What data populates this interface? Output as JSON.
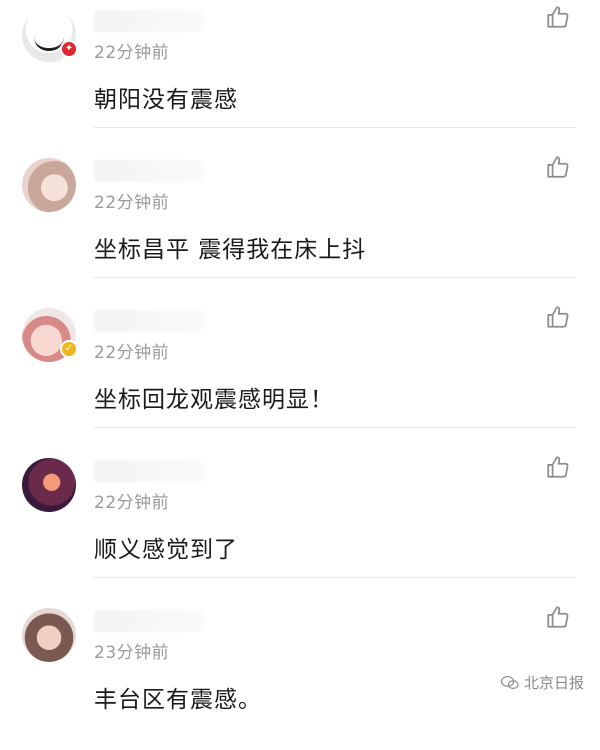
{
  "comments": [
    {
      "time": "22分钟前",
      "text": "朝阳没有震感",
      "badge": "red"
    },
    {
      "time": "22分钟前",
      "text": "坐标昌平 震得我在床上抖",
      "badge": ""
    },
    {
      "time": "22分钟前",
      "text": "坐标回龙观震感明显！",
      "badge": "gold"
    },
    {
      "time": "22分钟前",
      "text": "顺义感觉到了",
      "badge": ""
    },
    {
      "time": "23分钟前",
      "text": "丰台区有震感。",
      "badge": ""
    }
  ],
  "watermark": {
    "label": "北京日报"
  },
  "icons": {
    "like": "thumbs-up-icon",
    "wechat": "wechat-icon"
  },
  "colors": {
    "badge_red": "#e0262f",
    "badge_gold": "#f2b51c",
    "time_gray": "#9a9a9a"
  }
}
